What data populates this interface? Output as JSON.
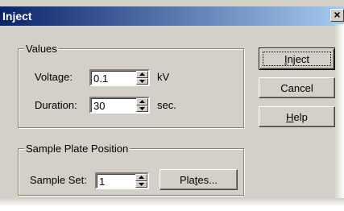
{
  "window": {
    "title": "Inject",
    "close_glyph": "×"
  },
  "values_group": {
    "legend": "Values",
    "voltage_label": "Voltage:",
    "voltage_value": "0.1",
    "voltage_unit": "kV",
    "duration_label": "Duration:",
    "duration_value": "30",
    "duration_unit": "sec."
  },
  "sample_plate_group": {
    "legend": "Sample Plate Position",
    "sample_set_label": "Sample Set:",
    "sample_set_value": "1",
    "plates_button": {
      "pre": "Pla",
      "mnemonic": "t",
      "post": "es..."
    }
  },
  "buttons": {
    "inject": {
      "mnemonic": "I",
      "rest": "nject"
    },
    "cancel": "Cancel",
    "help": {
      "mnemonic": "H",
      "rest": "elp"
    }
  },
  "icons": {
    "spin_up": "spin-up-arrow-icon",
    "spin_down": "spin-down-arrow-icon",
    "close": "close-icon"
  }
}
